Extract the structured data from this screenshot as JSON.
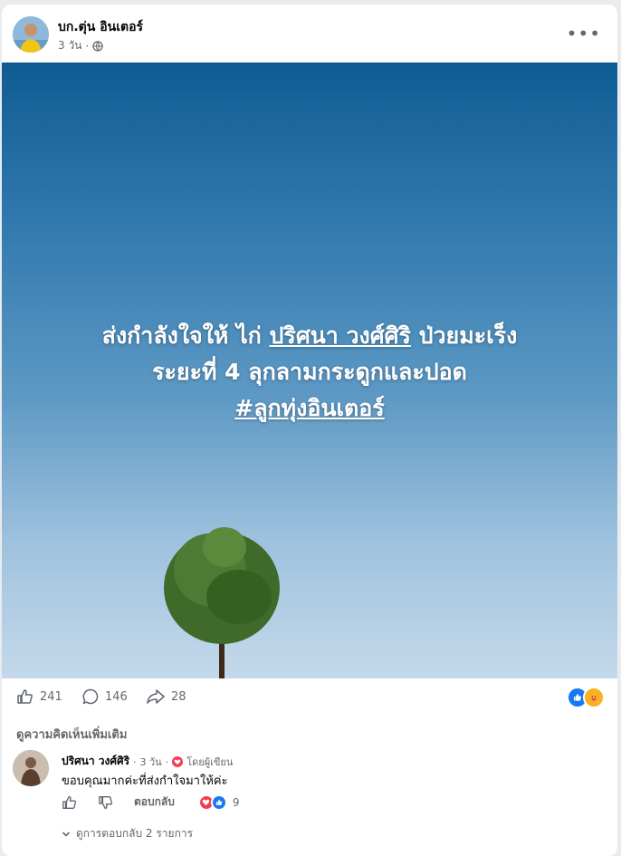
{
  "post": {
    "author": "บก.ตุ่น อินเตอร์",
    "time": "3 วัน",
    "separator": "·",
    "privacy_icon": "globe-icon",
    "more_icon": "•••"
  },
  "media": {
    "line1_prefix": "ส่งกำลังใจให้ ไก่ ",
    "line1_link": "ปริศนา วงศ์ศิริ",
    "line1_suffix": " ป่วยมะเร็ง",
    "line2": "ระยะที่ 4 ลุกลามกระดูกและปอด",
    "line3_hashtag": "#ลูกทุ่งอินเตอร์"
  },
  "actions": {
    "likes": "241",
    "comments": "146",
    "shares": "28"
  },
  "reactions": {
    "icons": [
      "like-icon",
      "care-icon"
    ],
    "colors": {
      "like": "#1877f2",
      "love": "#f33e58",
      "care": "#f7b125"
    }
  },
  "comments_section": {
    "view_more": "ดูความคิดเห็นเพิ่มเติม",
    "comment": {
      "name": "ปริศนา วงศ์ศิริ",
      "time": "3 วัน",
      "author_badge": "โดยผู้เขียน",
      "text": "ขอบคุณมากค่ะที่ส่งกำใจมาให้ค่ะ",
      "reply_label": "ตอบกลับ",
      "reaction_count": "9"
    },
    "view_replies": "ดูการตอบกลับ 2 รายการ"
  }
}
